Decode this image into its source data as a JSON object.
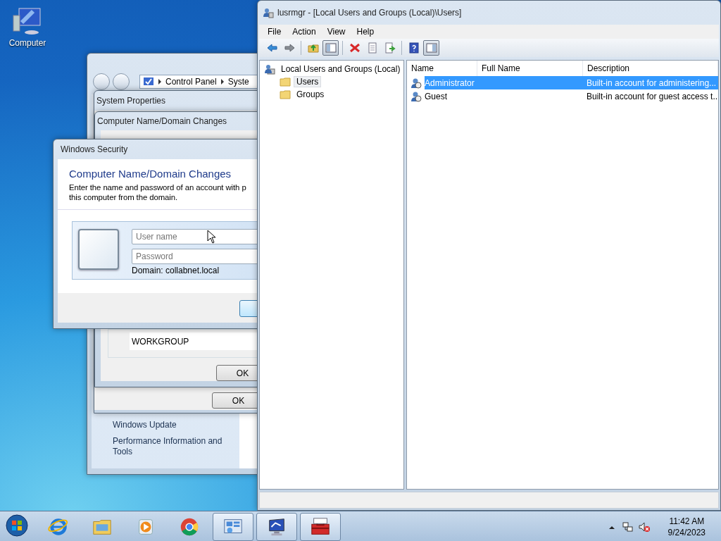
{
  "desktop_icons": [
    {
      "label": "Computer"
    }
  ],
  "control_panel": {
    "breadcrumb": [
      "Control Panel",
      "Syste"
    ],
    "links": [
      "Windows Update",
      "Performance Information and Tools"
    ]
  },
  "system_properties": {
    "title": "System Properties",
    "ok": "OK"
  },
  "name_changes": {
    "title": "Computer Name/Domain Changes",
    "workgroup": "WORKGROUP",
    "ok": "OK"
  },
  "security": {
    "title": "Windows Security",
    "heading": "Computer Name/Domain Changes",
    "lines": [
      "Enter the name and password of an account with p",
      "this computer from the domain."
    ],
    "username": {
      "placeholder": "User name"
    },
    "password": {
      "placeholder": "Password"
    },
    "domain": "Domain: collabnet.local"
  },
  "mmc": {
    "title": "lusrmgr - [Local Users and Groups (Local)\\Users]",
    "menu": [
      "File",
      "Action",
      "View",
      "Help"
    ],
    "toolbar": [
      {
        "kind": "back",
        "pressed": false
      },
      {
        "kind": "forward",
        "pressed": false
      },
      {
        "kind": "sep"
      },
      {
        "kind": "up",
        "pressed": false
      },
      {
        "kind": "tree",
        "pressed": true
      },
      {
        "kind": "sep"
      },
      {
        "kind": "delete",
        "pressed": false
      },
      {
        "kind": "properties",
        "pressed": false
      },
      {
        "kind": "export",
        "pressed": false
      },
      {
        "kind": "sep"
      },
      {
        "kind": "help",
        "pressed": false
      },
      {
        "kind": "action",
        "pressed": true
      }
    ],
    "tree": {
      "label": "Local Users and Groups (Local)",
      "children": [
        {
          "label": "Users",
          "selected": true
        },
        {
          "label": "Groups",
          "selected": false
        }
      ]
    },
    "columns": [
      "Name",
      "Full Name",
      "Description"
    ],
    "rows": [
      {
        "name": "Administrator",
        "description": "Built-in account for administering...",
        "selected": true
      },
      {
        "name": "Guest",
        "description": "Built-in account for guest access t...",
        "selected": false
      }
    ]
  },
  "taskbar": {
    "apps": [
      {
        "kind": "ie",
        "open": false
      },
      {
        "kind": "explorer",
        "open": false
      },
      {
        "kind": "media",
        "open": false
      },
      {
        "kind": "chrome",
        "open": false
      },
      {
        "kind": "control",
        "open": true
      },
      {
        "kind": "computer",
        "open": true
      },
      {
        "kind": "toolbox",
        "open": true
      }
    ],
    "time": "11:42 AM",
    "date": "9/24/2023"
  }
}
